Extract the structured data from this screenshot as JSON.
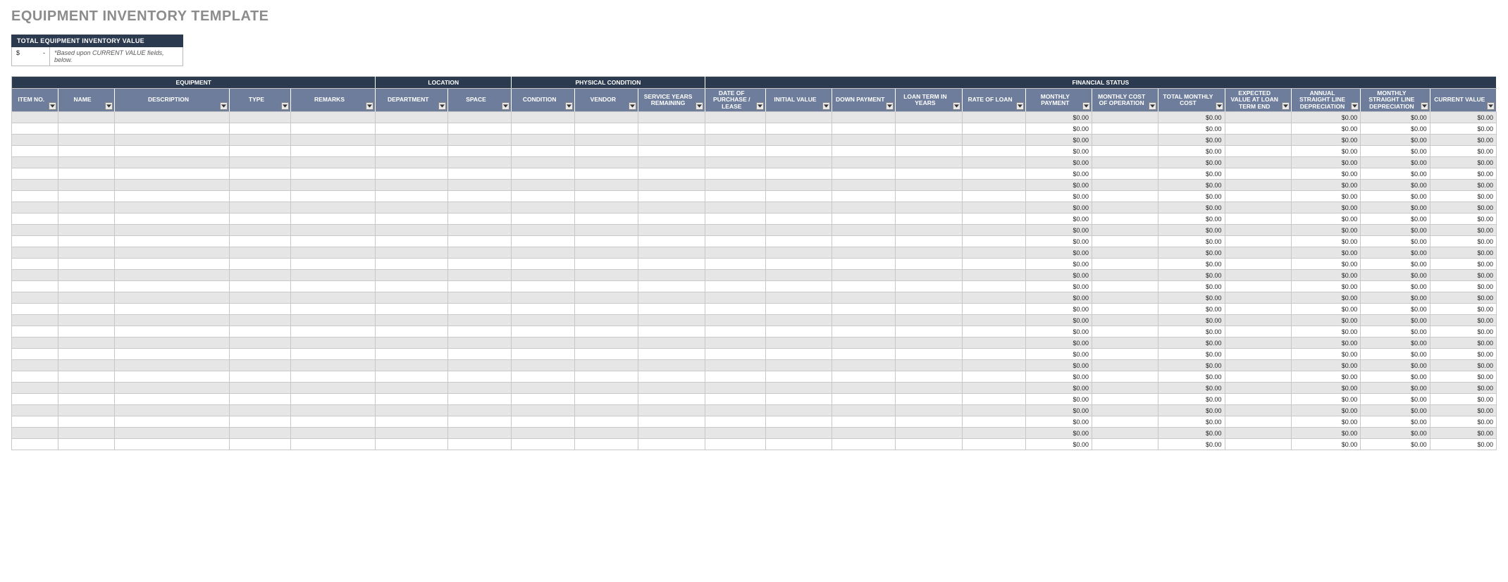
{
  "title": "EQUIPMENT INVENTORY TEMPLATE",
  "summary": {
    "label": "TOTAL EQUIPMENT INVENTORY VALUE",
    "currency_symbol": "$",
    "value_display": "-",
    "note": "*Based upon CURRENT VALUE fields, below."
  },
  "groups": [
    {
      "label": "EQUIPMENT",
      "span": 5
    },
    {
      "label": "LOCATION",
      "span": 2
    },
    {
      "label": "PHYSICAL CONDITION",
      "span": 3
    },
    {
      "label": "FINANCIAL STATUS",
      "span": 12
    }
  ],
  "columns": [
    {
      "key": "item_no",
      "label": "ITEM NO.",
      "class": "c-itemno"
    },
    {
      "key": "name",
      "label": "NAME",
      "class": "c-name"
    },
    {
      "key": "description",
      "label": "DESCRIPTION",
      "class": "c-desc"
    },
    {
      "key": "type",
      "label": "TYPE",
      "class": "c-type"
    },
    {
      "key": "remarks",
      "label": "REMARKS",
      "class": "c-remarks"
    },
    {
      "key": "department",
      "label": "DEPARTMENT",
      "class": "c-dept"
    },
    {
      "key": "space",
      "label": "SPACE",
      "class": "c-space"
    },
    {
      "key": "condition",
      "label": "CONDITION",
      "class": "c-cond"
    },
    {
      "key": "vendor",
      "label": "VENDOR",
      "class": "c-vendor"
    },
    {
      "key": "service_years_remaining",
      "label": "SERVICE YEARS REMAINING",
      "class": "c-svcyrs"
    },
    {
      "key": "date_of_purchase_lease",
      "label": "DATE OF PURCHASE / LEASE",
      "class": "c-date"
    },
    {
      "key": "initial_value",
      "label": "INITIAL VALUE",
      "class": "c-initval"
    },
    {
      "key": "down_payment",
      "label": "DOWN PAYMENT",
      "class": "c-down"
    },
    {
      "key": "loan_term_in_years",
      "label": "LOAN TERM IN YEARS",
      "class": "c-loanterm"
    },
    {
      "key": "rate_of_loan",
      "label": "RATE OF LOAN",
      "class": "c-rate"
    },
    {
      "key": "monthly_payment",
      "label": "MONTHLY PAYMENT",
      "class": "c-mpay"
    },
    {
      "key": "monthly_cost_of_operation",
      "label": "MONTHLY COST OF OPERATION",
      "class": "c-mcost"
    },
    {
      "key": "total_monthly_cost",
      "label": "TOTAL MONTHLY COST",
      "class": "c-tmcost"
    },
    {
      "key": "expected_value_at_loan_term_end",
      "label": "EXPECTED VALUE AT LOAN TERM END",
      "class": "c-expval"
    },
    {
      "key": "annual_straight_line_depreciation",
      "label": "ANNUAL STRAIGHT LINE DEPRECIATION",
      "class": "c-annsl"
    },
    {
      "key": "monthly_straight_line_depreciation",
      "label": "MONTHLY STRAIGHT LINE DEPRECIATION",
      "class": "c-monsl"
    },
    {
      "key": "current_value",
      "label": "CURRENT VALUE",
      "class": "c-curval"
    }
  ],
  "calc_columns": [
    "monthly_payment",
    "total_monthly_cost",
    "annual_straight_line_depreciation",
    "monthly_straight_line_depreciation",
    "current_value"
  ],
  "calc_default": "$0.00",
  "row_count": 30
}
